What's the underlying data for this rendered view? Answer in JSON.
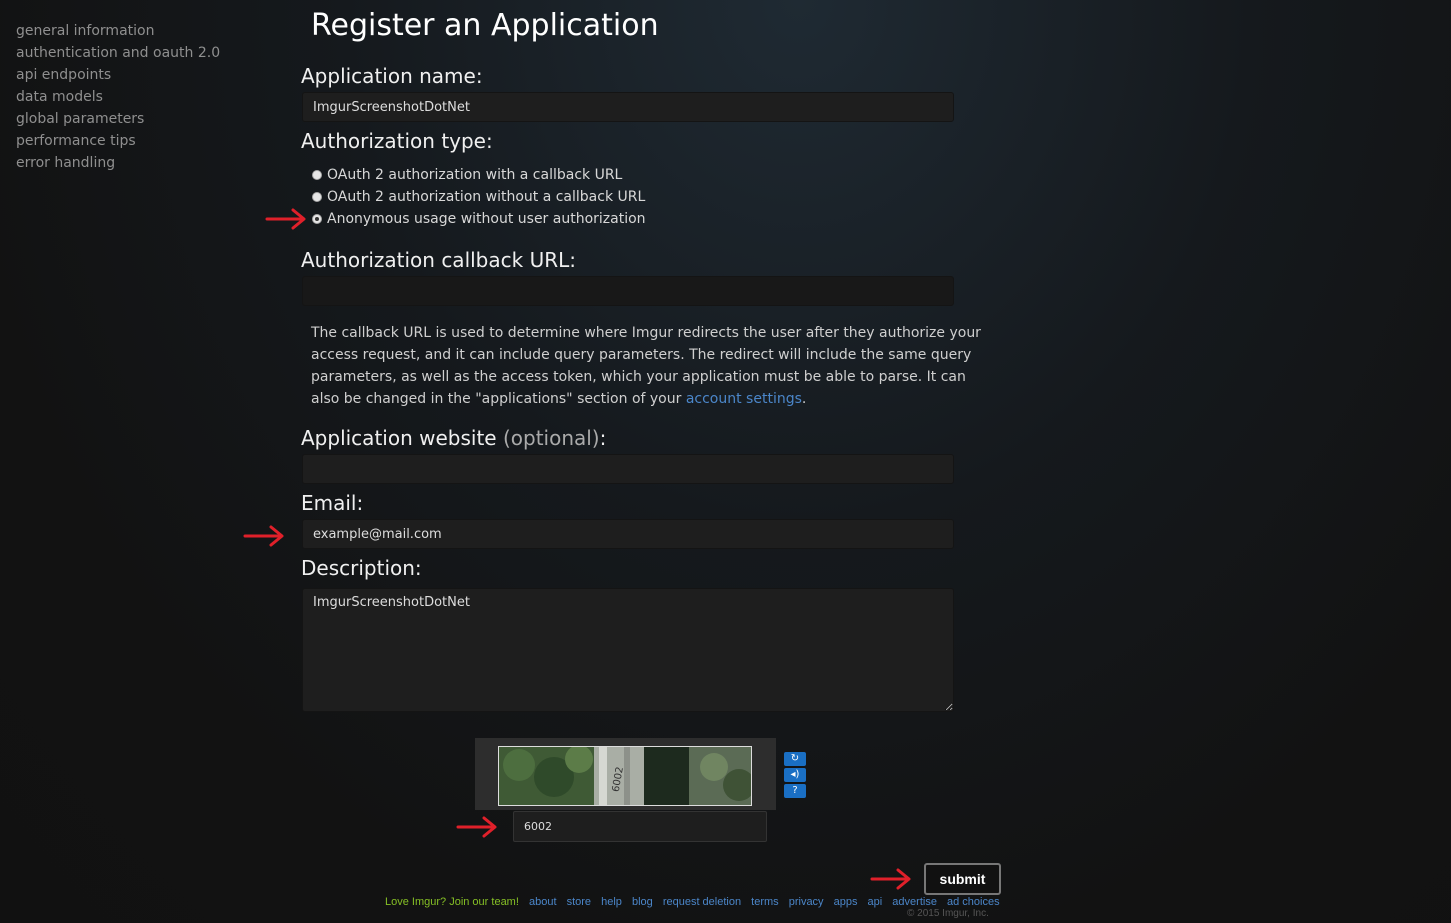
{
  "sidebar": {
    "items": [
      {
        "label": "general information"
      },
      {
        "label": "authentication and oauth 2.0"
      },
      {
        "label": "api endpoints"
      },
      {
        "label": "data models"
      },
      {
        "label": "global parameters"
      },
      {
        "label": "performance tips"
      },
      {
        "label": "error handling"
      }
    ]
  },
  "page": {
    "title": "Register an Application"
  },
  "form": {
    "app_name": {
      "label": "Application name:",
      "value": "ImgurScreenshotDotNet"
    },
    "auth_type": {
      "label": "Authorization type:",
      "options": [
        {
          "label": "OAuth 2 authorization with a callback URL",
          "checked": false
        },
        {
          "label": "OAuth 2 authorization without a callback URL",
          "checked": false
        },
        {
          "label": "Anonymous usage without user authorization",
          "checked": true
        }
      ]
    },
    "callback": {
      "label": "Authorization callback URL:",
      "value": "",
      "help_text": "The callback URL is used to determine where Imgur redirects the user after they authorize your access request, and it can include query parameters. The redirect will include the same query parameters, as well as the access token, which your application must be able to parse. It can also be changed in the \"applications\" section of your ",
      "help_link": "account settings",
      "help_end": "."
    },
    "website": {
      "label": "Application website",
      "optional": "(optional)",
      "colon": ":",
      "value": ""
    },
    "email": {
      "label": "Email:",
      "value": "example@mail.com"
    },
    "description": {
      "label": "Description:",
      "value": "ImgurScreenshotDotNet"
    },
    "captcha": {
      "value": "6002",
      "image_text": "6002",
      "icons": [
        "refresh-icon",
        "audio-icon",
        "help-icon"
      ]
    },
    "submit_label": "submit"
  },
  "footer": {
    "team": "Love Imgur? Join our team!",
    "links": [
      "about",
      "store",
      "help",
      "blog",
      "request deletion",
      "terms",
      "privacy",
      "apps",
      "api",
      "advertise",
      "ad choices"
    ],
    "copyright": "© 2015 Imgur, Inc."
  },
  "colors": {
    "link": "#4b86c9",
    "team": "#85bf25",
    "annotation_arrow": "#e0202a",
    "captcha_button": "#1a6fc4"
  }
}
